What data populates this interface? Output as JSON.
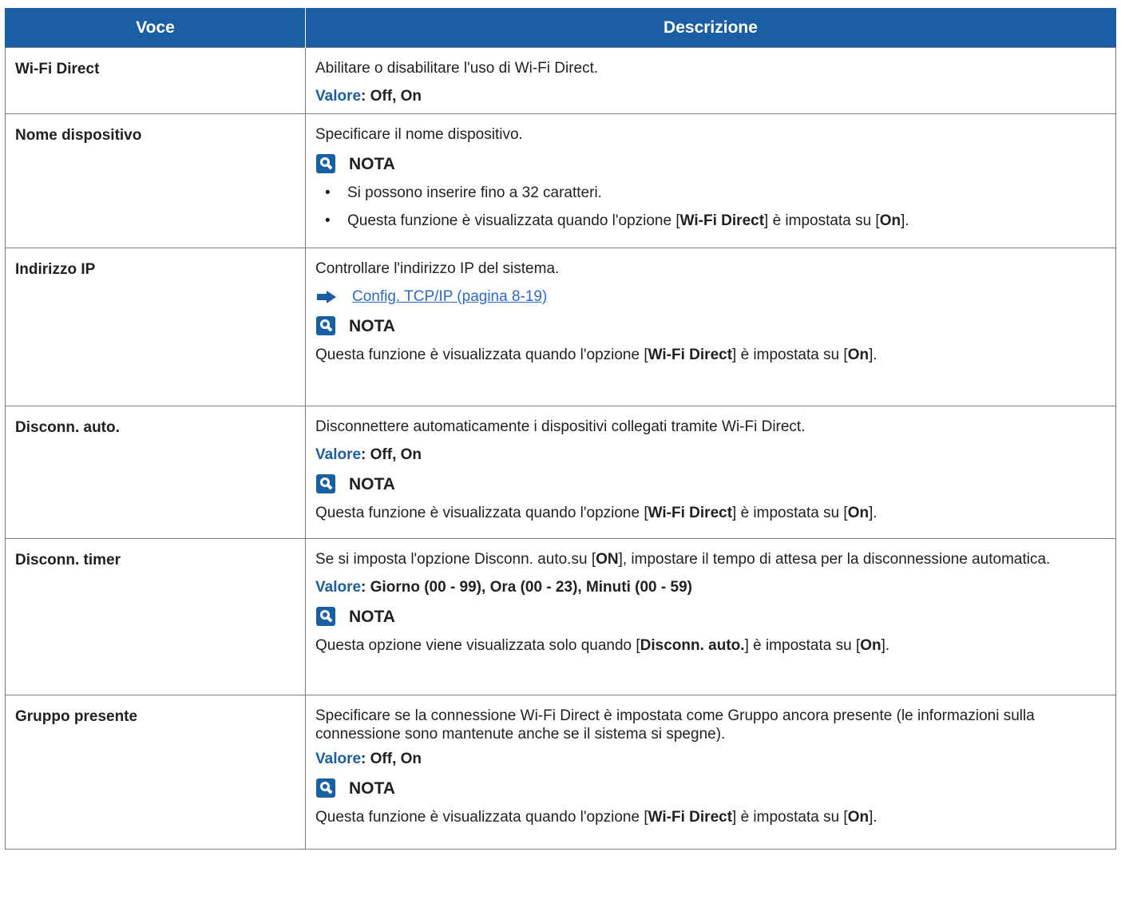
{
  "header": {
    "col1": "Voce",
    "col2": "Descrizione"
  },
  "note_title": "NOTA",
  "value_label": "Valore",
  "rows": [
    {
      "item": "Wi-Fi Direct",
      "desc": "Abilitare o disabilitare l'uso di Wi-Fi Direct.",
      "value": ": Off, On"
    },
    {
      "item": "Nome dispositivo",
      "desc": "Specificare il nome dispositivo.",
      "bullets": [
        "Si possono inserire fino a 32 caratteri.",
        {
          "pre": "Questa funzione è visualizzata quando l'opzione [",
          "bold": "Wi-Fi Direct",
          "mid": "] è impostata su [",
          "bold2": "On",
          "post": "]."
        }
      ]
    },
    {
      "item": "Indirizzo IP",
      "desc": "Controllare l'indirizzo IP del sistema.",
      "link": "Config. TCP/IP (pagina 8-19)",
      "note": {
        "pre": "Questa funzione è visualizzata quando l'opzione [",
        "bold": "Wi-Fi Direct",
        "mid": "] è impostata su [",
        "bold2": "On",
        "post": "]."
      }
    },
    {
      "item": "Disconn. auto.",
      "desc": "Disconnettere automaticamente i dispositivi collegati tramite Wi-Fi Direct.",
      "value": ": Off, On",
      "note": {
        "pre": "Questa funzione è visualizzata quando l'opzione [",
        "bold": "Wi-Fi Direct",
        "mid": "] è impostata su [",
        "bold2": "On",
        "post": "]."
      }
    },
    {
      "item": "Disconn. timer",
      "desc_pre": "Se si imposta l'opzione Disconn. auto.su [",
      "desc_bold": "ON",
      "desc_post": "], impostare il tempo di attesa per la disconnessione automatica.",
      "value": ": Giorno (00 - 99), Ora (00 - 23), Minuti (00 - 59)",
      "note": {
        "pre": "Questa opzione viene visualizzata solo quando [",
        "bold": "Disconn. auto.",
        "mid": "] è impostata su [",
        "bold2": "On",
        "post": "]."
      }
    },
    {
      "item": "Gruppo presente",
      "desc": "Specificare se la connessione Wi-Fi Direct è impostata come Gruppo ancora presente (le informazioni sulla connessione sono mantenute anche se il sistema si spegne).",
      "value": ": Off, On",
      "note": {
        "pre": "Questa funzione è visualizzata quando l'opzione [",
        "bold": "Wi-Fi Direct",
        "mid": "] è impostata su [",
        "bold2": "On",
        "post": "]."
      }
    }
  ]
}
